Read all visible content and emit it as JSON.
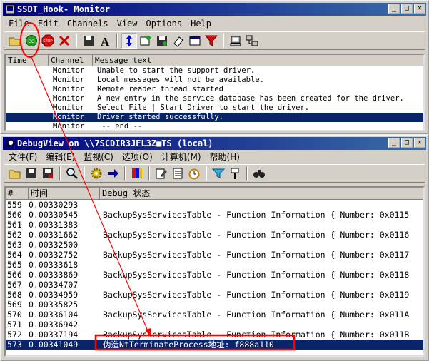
{
  "monitor": {
    "title": "SSDT_Hook- Monitor",
    "menu": [
      "File",
      "Edit",
      "Channels",
      "View",
      "Options",
      "Help"
    ],
    "columns": [
      "Time",
      "Channel",
      "Message text"
    ],
    "rows": [
      {
        "time": "",
        "channel": "Monitor",
        "message": "Unable to start the support driver."
      },
      {
        "time": "",
        "channel": "Monitor",
        "message": "Local messages will not be available."
      },
      {
        "time": "",
        "channel": "Monitor",
        "message": "Remote reader thread started"
      },
      {
        "time": "",
        "channel": "Monitor",
        "message": "A new entry in the service database has been created for the driver."
      },
      {
        "time": "",
        "channel": "Monitor",
        "message": "Select File | Start Driver to start the driver."
      },
      {
        "time": "",
        "channel": "Monitor",
        "message": "Driver started successfully.",
        "selected": true
      },
      {
        "time": "",
        "channel": "Monitor",
        "message": " -- end --"
      }
    ]
  },
  "debugview": {
    "title": "DebugView on \\\\7SCDIR3JFL3Z■TS (local)",
    "menu": [
      "文件(F)",
      "编辑(E)",
      "监视(C)",
      "选项(O)",
      "计算机(M)",
      "帮助(H)"
    ],
    "columns": [
      "#",
      "时间",
      "Debug 状态"
    ],
    "rows": [
      {
        "num": "559",
        "time": "0.00330293",
        "text": ""
      },
      {
        "num": "560",
        "time": "0.00330545",
        "text": "BackupSysServicesTable - Function Information { Number: 0x0115"
      },
      {
        "num": "561",
        "time": "0.00331383",
        "text": ""
      },
      {
        "num": "562",
        "time": "0.00331662",
        "text": "BackupSysServicesTable - Function Information { Number: 0x0116"
      },
      {
        "num": "563",
        "time": "0.00332500",
        "text": ""
      },
      {
        "num": "564",
        "time": "0.00332752",
        "text": "BackupSysServicesTable - Function Information { Number: 0x0117"
      },
      {
        "num": "565",
        "time": "0.00333618",
        "text": ""
      },
      {
        "num": "566",
        "time": "0.00333869",
        "text": "BackupSysServicesTable - Function Information { Number: 0x0118"
      },
      {
        "num": "567",
        "time": "0.00334707",
        "text": ""
      },
      {
        "num": "568",
        "time": "0.00334959",
        "text": "BackupSysServicesTable - Function Information { Number: 0x0119"
      },
      {
        "num": "569",
        "time": "0.00335825",
        "text": ""
      },
      {
        "num": "570",
        "time": "0.00336104",
        "text": "BackupSysServicesTable - Function Information { Number: 0x011A"
      },
      {
        "num": "571",
        "time": "0.00336942",
        "text": ""
      },
      {
        "num": "572",
        "time": "0.00337194",
        "text": "BackupSysServicesTable - Function Information { Number: 0x011B"
      },
      {
        "num": "573",
        "time": "0.00341049",
        "text": "伪造NtTerminateProcess地址: f888a110",
        "selected": true
      }
    ]
  },
  "colors": {
    "titlebar": "#000080",
    "selection": "#0a246a",
    "annotation": "#ff0000"
  }
}
